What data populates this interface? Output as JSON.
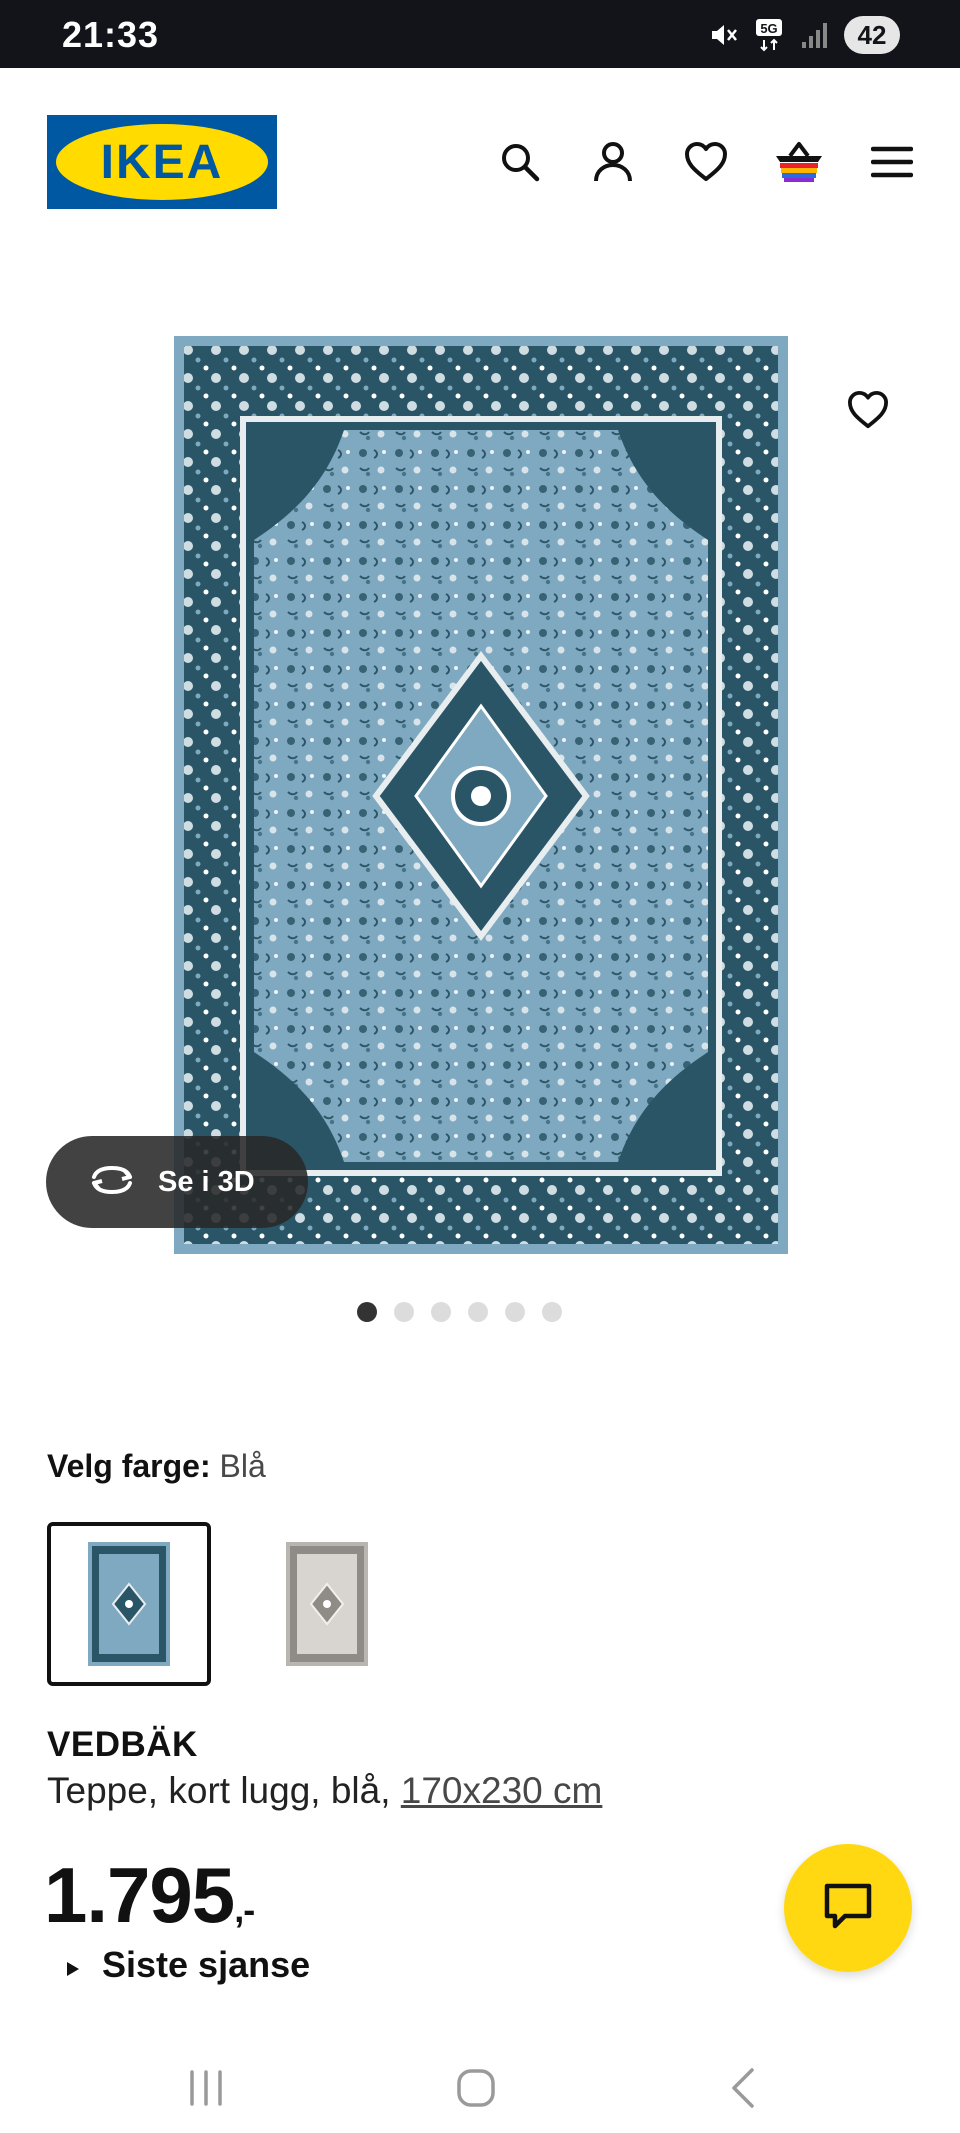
{
  "status_bar": {
    "time": "21:33",
    "network": "5G",
    "battery": "42"
  },
  "header": {
    "logo_text": "IKEA",
    "icons": [
      "search-icon",
      "account-icon",
      "heart-icon",
      "basket-icon",
      "menu-icon"
    ]
  },
  "gallery": {
    "view_3d_label": "Se i 3D",
    "dot_count": 6,
    "active_dot": 1
  },
  "color_picker": {
    "label": "Velg farge:",
    "value": "Blå",
    "options": [
      "Blå",
      "Grå"
    ]
  },
  "product": {
    "name": "VEDBÄK",
    "description": "Teppe, kort lugg, blå,",
    "size": "170x230 cm",
    "price": "1.795",
    "price_suffix": ",-",
    "badge": "Siste sjanse"
  },
  "colors": {
    "brand_blue": "#0058a3",
    "brand_yellow": "#ffdb00",
    "chat_yellow": "#ffd812",
    "rug_blue": "#7fa9c0",
    "rug_dark": "#2a5566"
  }
}
